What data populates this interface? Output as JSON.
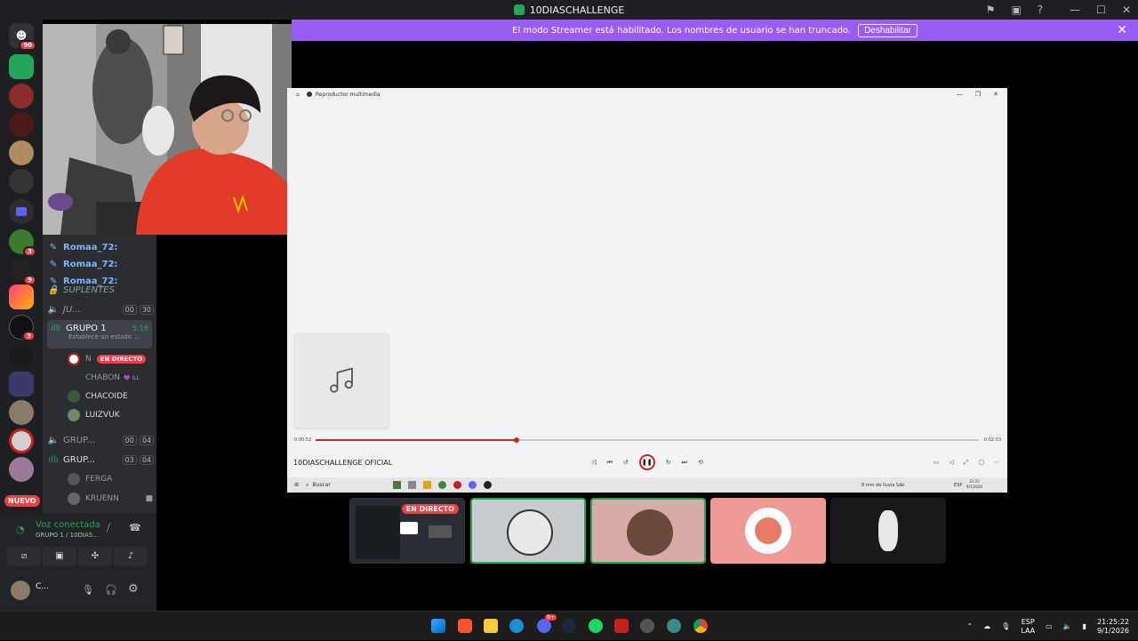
{
  "window": {
    "title": "10DIASCHALLENGE"
  },
  "banner": {
    "text": "El modo Streamer está habilitado. Los nombres de usuario se han truncado.",
    "disable_label": "Deshabilitar"
  },
  "servers": {
    "badges": [
      "90",
      "3",
      "9",
      "3"
    ],
    "new_label": "NUEVO"
  },
  "channels": {
    "pinned_users": [
      "Romaa_72:",
      "Romaa_72:",
      "Romaa_72:"
    ],
    "suplentes": "SUPLENTES",
    "ju": {
      "label": "JU...",
      "tag1": "00",
      "tag2": "30"
    },
    "grupo1": {
      "label": "GRUPO 1",
      "time": "5:18",
      "status": "Establece un estado ..."
    },
    "grupo1_users": [
      {
        "name": "N",
        "live": "EN DIRECTO"
      },
      {
        "name": "CHABON",
        "extra": "💜 ILL"
      },
      {
        "name": "CHACOIDE"
      },
      {
        "name": "LUIZVUK"
      }
    ],
    "grup2": {
      "label": "GRUP...",
      "tag1": "00",
      "tag2": "04"
    },
    "grup3": {
      "label": "GRUP...",
      "tag1": "03",
      "tag2": "04"
    },
    "grup3_users": [
      "FERGA",
      "KRUENN"
    ]
  },
  "voice": {
    "status": "Voz conectada",
    "channel": "GRUPO 1 / 10DIAS...",
    "user": "C..."
  },
  "media_player": {
    "window_title": "Reproductor multimedia",
    "time_elapsed": "0:00:52",
    "time_total": "0:02:03",
    "progress": 0.303,
    "track_title": "10DIASCHALLENGE OFICIAL",
    "search_placeholder": "Buscar",
    "weather": "8 mm de lluvia Sáb",
    "lang": "ESP",
    "clock_time": "21:25",
    "clock_date": "9/1/2026"
  },
  "stream_tiles": {
    "live_label": "EN DIRECTO"
  },
  "taskbar": {
    "lang1": "ESP",
    "lang2": "LAA",
    "time": "21:25:22",
    "date": "9/1/2026",
    "discord_badge": "9+"
  },
  "colors": {
    "accent": "#9b5cf5",
    "live": "#f23f43",
    "online": "#23a55a",
    "progress": "#c42b1c"
  }
}
